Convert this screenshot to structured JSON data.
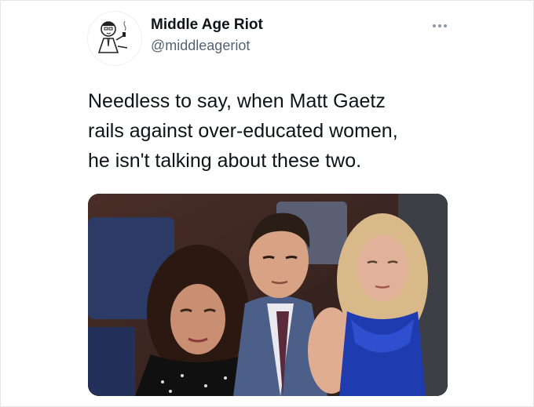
{
  "tweet": {
    "author": {
      "name": "Middle Age Riot",
      "handle": "@middleageriot"
    },
    "text": "Needless to say, when Matt Gaetz\nrails against over-educated women,\nhe isn't talking about these two.",
    "media": {
      "description_icon": "photo-icon"
    }
  },
  "colors": {
    "text_primary": "#0f1419",
    "text_secondary": "#536471",
    "border": "#e6e6e6"
  }
}
